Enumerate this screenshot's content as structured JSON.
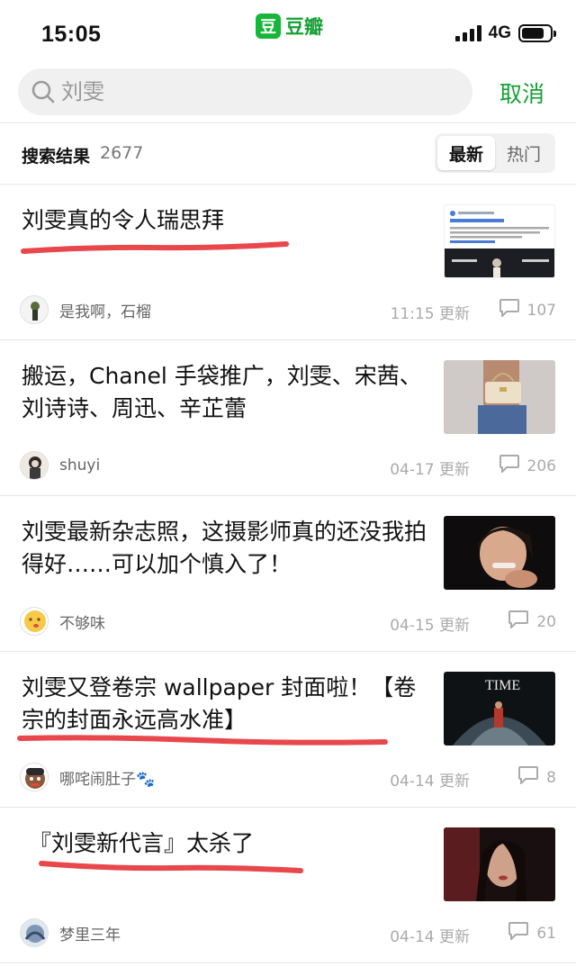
{
  "status_bar": {
    "time": "15:05",
    "network": "4G",
    "app_name": "豆瓣",
    "app_logo_char": "豆"
  },
  "search": {
    "placeholder": "刘雯",
    "cancel_label": "取消"
  },
  "results": {
    "label": "搜索结果",
    "count": "2677",
    "sort_options": [
      "最新",
      "热门"
    ],
    "active_sort": "最新"
  },
  "items": [
    {
      "title": "刘雯真的令人瑞思拜",
      "author": "是我啊，石榴",
      "updated": "11:15 更新",
      "comments": "107"
    },
    {
      "title": "搬运，Chanel 手袋推广，刘雯、宋茜、刘诗诗、周迅、辛芷蕾",
      "author": "shuyi",
      "updated": "04-17 更新",
      "comments": "206"
    },
    {
      "title": "刘雯最新杂志照，这摄影师真的还没我拍得好……可以加个慎入了！",
      "author": "不够味",
      "updated": "04-15 更新",
      "comments": "20"
    },
    {
      "title": "刘雯又登卷宗 wallpaper 封面啦！【卷宗的封面永远高水准】",
      "author": "哪咤闹肚子🐾",
      "updated": "04-14 更新",
      "comments": "8"
    },
    {
      "title": "『刘雯新代言』太杀了",
      "author": "梦里三年",
      "updated": "04-14 更新",
      "comments": "61"
    }
  ],
  "thumb_text": {
    "magazine": "TIME"
  },
  "colors": {
    "accent": "#16a135",
    "underline": "#e8474c"
  }
}
